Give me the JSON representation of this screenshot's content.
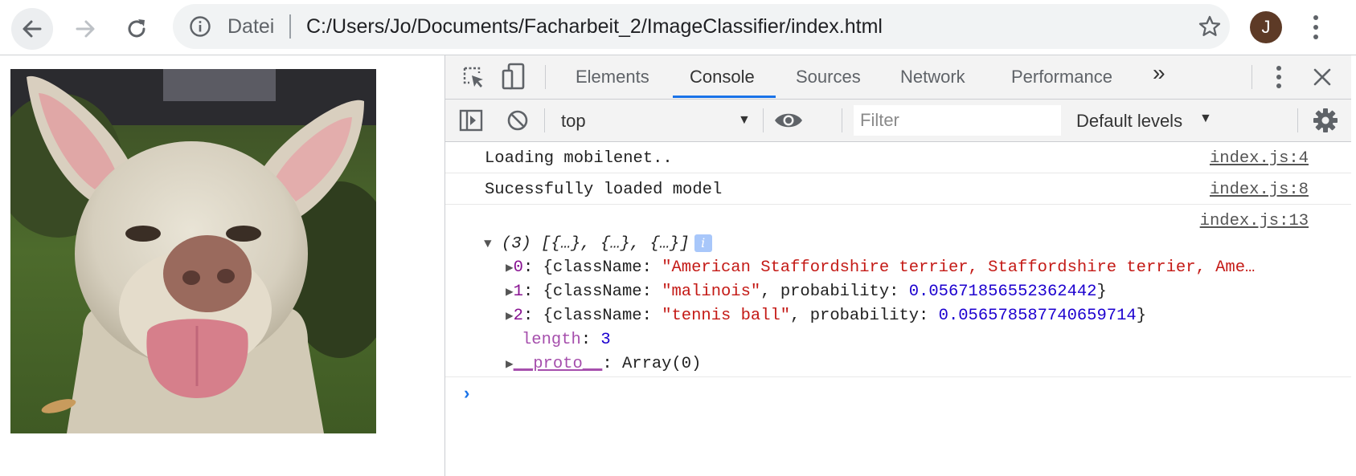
{
  "browser": {
    "scheme_label": "Datei",
    "url": "C:/Users/Jo/Documents/Facharbeit_2/ImageClassifier/index.html",
    "avatar_initial": "J",
    "icons": [
      "back-arrow-icon",
      "forward-arrow-icon",
      "reload-icon",
      "info-icon",
      "star-icon",
      "more-vert-icon"
    ]
  },
  "page": {
    "image_subject": "photo-dog"
  },
  "devtools": {
    "tabs": [
      {
        "label": "Elements"
      },
      {
        "label": "Console",
        "active": true
      },
      {
        "label": "Sources"
      },
      {
        "label": "Network"
      },
      {
        "label": "Performance"
      }
    ],
    "more_tabs": "»",
    "context": "top",
    "filter_placeholder": "Filter",
    "levels": "Default levels",
    "accent_color": "#1a73e8"
  },
  "console": {
    "messages": [
      {
        "text": "Loading mobilenet..",
        "source": "index.js:4"
      },
      {
        "text": "Sucessfully loaded model",
        "source": "index.js:8"
      },
      {
        "source": "index.js:13"
      }
    ],
    "array_summary": "(3) [{…}, {…}, {…}]",
    "items": [
      {
        "index": "0",
        "prefix": ": {className: ",
        "class_name": "\"American Staffordshire terrier, Staffordshire terrier, Ame…",
        "middle": "",
        "probability": "",
        "suffix": ""
      },
      {
        "index": "1",
        "prefix": ": {className: ",
        "class_name": "\"malinois\"",
        "middle": ", probability: ",
        "probability": "0.05671856552362442",
        "suffix": "}"
      },
      {
        "index": "2",
        "prefix": ": {className: ",
        "class_name": "\"tennis ball\"",
        "middle": ", probability: ",
        "probability": "0.056578587740659714",
        "suffix": "}"
      }
    ],
    "length_key": "length",
    "length_value": "3",
    "proto_key": "__proto__",
    "proto_value": ": Array(0)"
  }
}
